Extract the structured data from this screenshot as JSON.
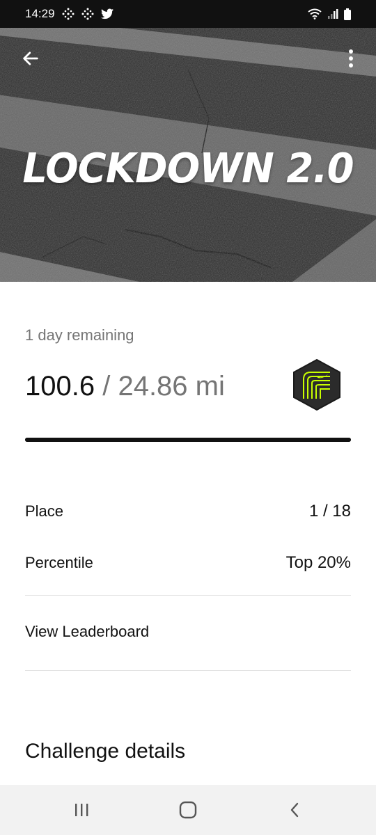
{
  "status_bar": {
    "time": "14:29",
    "icons": [
      "activity-app-icon",
      "activity-app-icon",
      "twitter-icon",
      "wifi-icon",
      "signal-icon",
      "battery-icon"
    ]
  },
  "hero": {
    "title": "LOCKDOWN 2.0",
    "back_icon": "arrow-left-icon",
    "menu_icon": "more-vertical-icon"
  },
  "challenge": {
    "remaining": "1 day remaining",
    "distance_done": "100.6",
    "separator": " / ",
    "distance_goal": "24.86 mi",
    "progress_fraction": 1.0,
    "badge_icon": "challenge-badge-icon",
    "badge_colors": {
      "fill": "#2b2b2b",
      "accent": "#c8ff00"
    }
  },
  "stats": [
    {
      "label": "Place",
      "value": "1 / 18"
    },
    {
      "label": "Percentile",
      "value": "Top 20%"
    }
  ],
  "leaderboard_link": "View Leaderboard",
  "section_title": "Challenge details",
  "nav_bar": {
    "icons": [
      "recent-apps-icon",
      "home-icon",
      "back-icon"
    ]
  }
}
